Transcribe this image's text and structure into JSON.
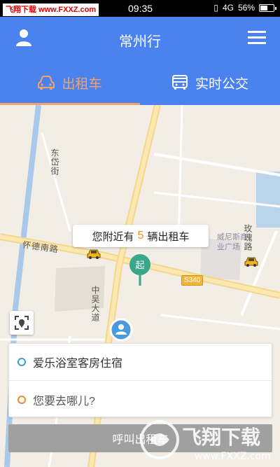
{
  "status_bar": {
    "watermark": "飞翔下载 www.FXXZ.com",
    "time": "09:35",
    "network": "4G",
    "battery_text": "56%",
    "battery_level": 0.56
  },
  "header": {
    "title": "常州行"
  },
  "tabs": [
    {
      "label": "出租车",
      "active": true
    },
    {
      "label": "实时公交",
      "active": false
    }
  ],
  "map": {
    "roads": {
      "huaide": "怀德南路",
      "dongdai": "东岱街",
      "zhongwu": "中吴大道",
      "meigui": "玫瑰路",
      "route_badge": "S340"
    },
    "poi": "威尼斯商业广场",
    "taxi_bubble": {
      "prefix": "您附近有",
      "count": "5",
      "suffix": "辆出租车"
    },
    "start_pin_label": "起"
  },
  "address": {
    "from": "爱乐浴室客房住宿",
    "to_placeholder": "您要去哪儿?"
  },
  "call_button": {
    "label": "呼叫出租车"
  },
  "site_watermark": {
    "brand": "飞翔下载",
    "url": "www.FXXZ.com"
  },
  "colors": {
    "primary": "#4a82f0",
    "accent": "#f4a267",
    "from_dot": "#3aa0d8",
    "to_dot": "#f08a2a",
    "pin": "#3aa68a"
  }
}
